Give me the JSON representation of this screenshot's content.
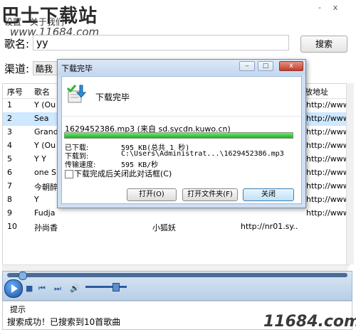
{
  "watermark": {
    "top": "巴士下载站",
    "url": "www.11684.com",
    "bottom": "11684.com"
  },
  "menu": [
    "设置",
    "关于我们"
  ],
  "window_controls": [
    "-",
    "x"
  ],
  "search": {
    "song_label": "歌名:",
    "song_value": "yy",
    "button": "搜索",
    "channel_label": "渠道:",
    "channel_value": "酷我"
  },
  "table": {
    "headers": [
      "序号",
      "歌名",
      "",
      "放地址"
    ],
    "rows": [
      {
        "n": "1",
        "title": "Y (Ou",
        "artist": "",
        "url": "http://www.k..."
      },
      {
        "n": "2",
        "title": "Sea",
        "artist": "",
        "url": "http://www.k..."
      },
      {
        "n": "3",
        "title": "Grand",
        "artist": "",
        "url": "http://www.k..."
      },
      {
        "n": "4",
        "title": "Y (Ou",
        "artist": "",
        "url": "http://www.k..."
      },
      {
        "n": "5",
        "title": "Y Y",
        "artist": "",
        "url": "http://www.k..."
      },
      {
        "n": "6",
        "title": "one S",
        "artist": "",
        "url": "http://www.k..."
      },
      {
        "n": "7",
        "title": "今朝醉",
        "artist": "",
        "url": "http://www.k..."
      },
      {
        "n": "8",
        "title": "Y",
        "artist": "",
        "url": "http://www.k..."
      },
      {
        "n": "9",
        "title": "Fudja",
        "artist": "",
        "url": "http://www.k..."
      },
      {
        "n": "10",
        "title": "孙尚香",
        "artist": "小狐妖",
        "url": "http://nr01.sy..."
      }
    ]
  },
  "dialog": {
    "title": "下载完毕",
    "heading": "下载完毕",
    "filename": "1629452386.mp3 (来自 sd.sycdn.kuwo.cn)",
    "progress": 1.0,
    "fields": [
      {
        "label": "已下载:",
        "value": "595 KB(总共 1 秒)"
      },
      {
        "label": "下载到:",
        "value": "C:\\Users\\Administrat...\\1629452386.mp3"
      },
      {
        "label": "传输速度:",
        "value": "595 KB/秒"
      }
    ],
    "checkbox": "下载完成后关闭此对话框(C)",
    "buttons": {
      "open": "打开(O)",
      "open_folder": "打开文件夹(F)",
      "close": "关闭"
    },
    "close_glyph": "x"
  },
  "player": {
    "seek_position": 0.05,
    "volume": 0.7
  },
  "hint": {
    "title": "提示",
    "message": "搜索成功！已搜索到10首歌曲"
  },
  "colors": {
    "selected_row": "#cde8ff",
    "progress": "#16b516",
    "player": "#b8cfe8"
  }
}
